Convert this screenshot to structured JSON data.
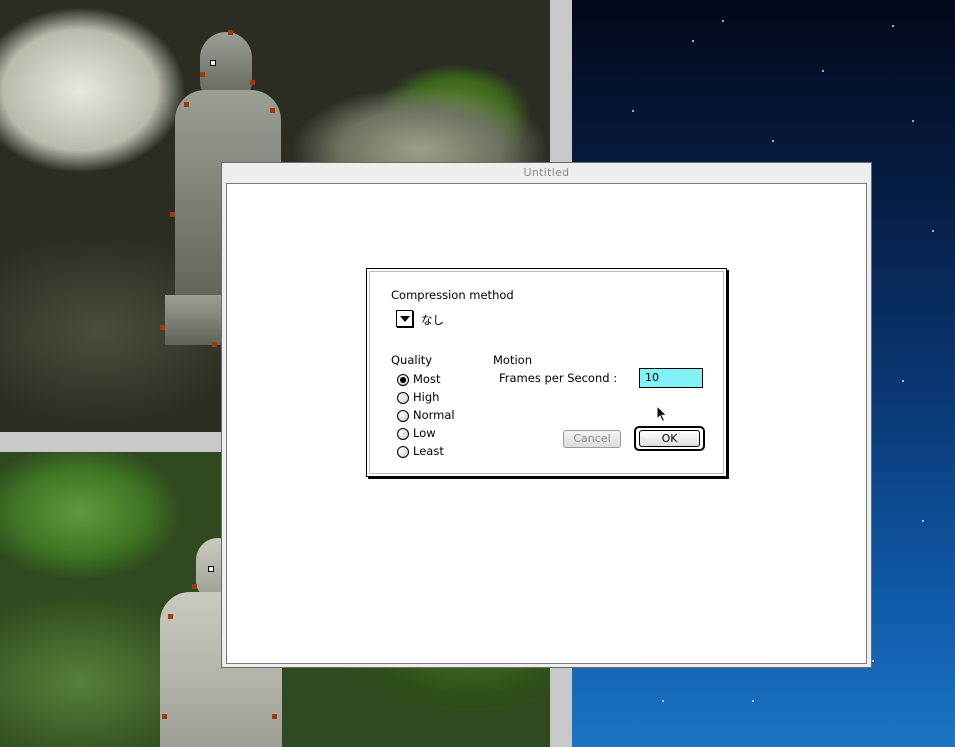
{
  "window": {
    "title": "Untitled"
  },
  "dialog": {
    "compression_label": "Compression method",
    "compression_value": "なし",
    "quality_label": "Quality",
    "quality_options": [
      "Most",
      "High",
      "Normal",
      "Low",
      "Least"
    ],
    "quality_selected": "Most",
    "motion_label": "Motion",
    "fps_label": "Frames per Second :",
    "fps_value": "10",
    "cancel_label": "Cancel",
    "ok_label": "OK"
  },
  "colors": {
    "fps_field_bg": "#80f2f8",
    "disabled_text": "#8a8a8a"
  }
}
